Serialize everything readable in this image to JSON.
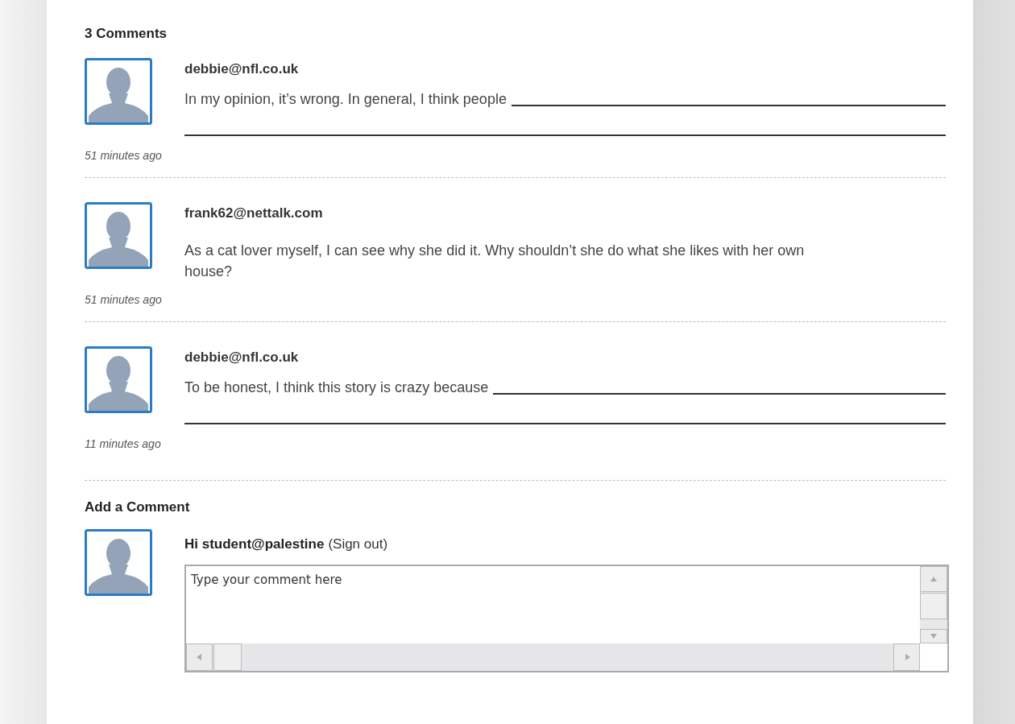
{
  "comments_heading": "3 Comments",
  "comments": [
    {
      "kind": "fill_in",
      "author": "debbie@nfl.co.uk",
      "text": "In my opinion, it’s wrong. In general, I think people",
      "time": "51 minutes ago"
    },
    {
      "kind": "text",
      "author": "frank62@nettalk.com",
      "text": "As a cat lover myself, I can see why she did it. Why shouldn’t she do what she likes with her own house?",
      "time": "51 minutes ago"
    },
    {
      "kind": "fill_in",
      "author": "debbie@nfl.co.uk",
      "text": "To be honest, I think this story is crazy because",
      "time": "11 minutes ago"
    }
  ],
  "add_comment": {
    "heading": "Add a Comment",
    "greeting": "Hi student@palestine",
    "sign_out": "(Sign out)",
    "placeholder": "Type your comment here"
  }
}
